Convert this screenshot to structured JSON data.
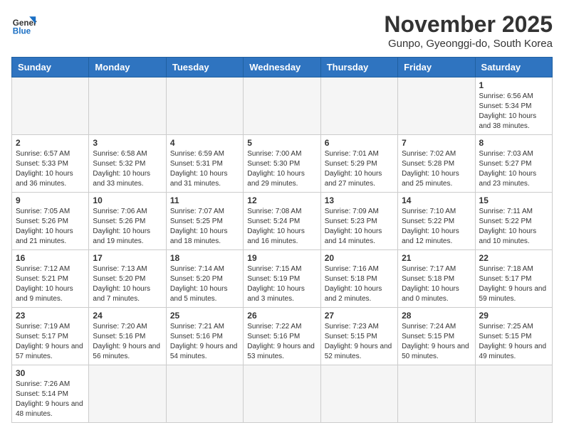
{
  "header": {
    "logo_general": "General",
    "logo_blue": "Blue",
    "title": "November 2025",
    "subtitle": "Gunpo, Gyeonggi-do, South Korea"
  },
  "weekdays": [
    "Sunday",
    "Monday",
    "Tuesday",
    "Wednesday",
    "Thursday",
    "Friday",
    "Saturday"
  ],
  "weeks": [
    [
      {
        "day": "",
        "info": ""
      },
      {
        "day": "",
        "info": ""
      },
      {
        "day": "",
        "info": ""
      },
      {
        "day": "",
        "info": ""
      },
      {
        "day": "",
        "info": ""
      },
      {
        "day": "",
        "info": ""
      },
      {
        "day": "1",
        "info": "Sunrise: 6:56 AM\nSunset: 5:34 PM\nDaylight: 10 hours and 38 minutes."
      }
    ],
    [
      {
        "day": "2",
        "info": "Sunrise: 6:57 AM\nSunset: 5:33 PM\nDaylight: 10 hours and 36 minutes."
      },
      {
        "day": "3",
        "info": "Sunrise: 6:58 AM\nSunset: 5:32 PM\nDaylight: 10 hours and 33 minutes."
      },
      {
        "day": "4",
        "info": "Sunrise: 6:59 AM\nSunset: 5:31 PM\nDaylight: 10 hours and 31 minutes."
      },
      {
        "day": "5",
        "info": "Sunrise: 7:00 AM\nSunset: 5:30 PM\nDaylight: 10 hours and 29 minutes."
      },
      {
        "day": "6",
        "info": "Sunrise: 7:01 AM\nSunset: 5:29 PM\nDaylight: 10 hours and 27 minutes."
      },
      {
        "day": "7",
        "info": "Sunrise: 7:02 AM\nSunset: 5:28 PM\nDaylight: 10 hours and 25 minutes."
      },
      {
        "day": "8",
        "info": "Sunrise: 7:03 AM\nSunset: 5:27 PM\nDaylight: 10 hours and 23 minutes."
      }
    ],
    [
      {
        "day": "9",
        "info": "Sunrise: 7:05 AM\nSunset: 5:26 PM\nDaylight: 10 hours and 21 minutes."
      },
      {
        "day": "10",
        "info": "Sunrise: 7:06 AM\nSunset: 5:26 PM\nDaylight: 10 hours and 19 minutes."
      },
      {
        "day": "11",
        "info": "Sunrise: 7:07 AM\nSunset: 5:25 PM\nDaylight: 10 hours and 18 minutes."
      },
      {
        "day": "12",
        "info": "Sunrise: 7:08 AM\nSunset: 5:24 PM\nDaylight: 10 hours and 16 minutes."
      },
      {
        "day": "13",
        "info": "Sunrise: 7:09 AM\nSunset: 5:23 PM\nDaylight: 10 hours and 14 minutes."
      },
      {
        "day": "14",
        "info": "Sunrise: 7:10 AM\nSunset: 5:22 PM\nDaylight: 10 hours and 12 minutes."
      },
      {
        "day": "15",
        "info": "Sunrise: 7:11 AM\nSunset: 5:22 PM\nDaylight: 10 hours and 10 minutes."
      }
    ],
    [
      {
        "day": "16",
        "info": "Sunrise: 7:12 AM\nSunset: 5:21 PM\nDaylight: 10 hours and 9 minutes."
      },
      {
        "day": "17",
        "info": "Sunrise: 7:13 AM\nSunset: 5:20 PM\nDaylight: 10 hours and 7 minutes."
      },
      {
        "day": "18",
        "info": "Sunrise: 7:14 AM\nSunset: 5:20 PM\nDaylight: 10 hours and 5 minutes."
      },
      {
        "day": "19",
        "info": "Sunrise: 7:15 AM\nSunset: 5:19 PM\nDaylight: 10 hours and 3 minutes."
      },
      {
        "day": "20",
        "info": "Sunrise: 7:16 AM\nSunset: 5:18 PM\nDaylight: 10 hours and 2 minutes."
      },
      {
        "day": "21",
        "info": "Sunrise: 7:17 AM\nSunset: 5:18 PM\nDaylight: 10 hours and 0 minutes."
      },
      {
        "day": "22",
        "info": "Sunrise: 7:18 AM\nSunset: 5:17 PM\nDaylight: 9 hours and 59 minutes."
      }
    ],
    [
      {
        "day": "23",
        "info": "Sunrise: 7:19 AM\nSunset: 5:17 PM\nDaylight: 9 hours and 57 minutes."
      },
      {
        "day": "24",
        "info": "Sunrise: 7:20 AM\nSunset: 5:16 PM\nDaylight: 9 hours and 56 minutes."
      },
      {
        "day": "25",
        "info": "Sunrise: 7:21 AM\nSunset: 5:16 PM\nDaylight: 9 hours and 54 minutes."
      },
      {
        "day": "26",
        "info": "Sunrise: 7:22 AM\nSunset: 5:16 PM\nDaylight: 9 hours and 53 minutes."
      },
      {
        "day": "27",
        "info": "Sunrise: 7:23 AM\nSunset: 5:15 PM\nDaylight: 9 hours and 52 minutes."
      },
      {
        "day": "28",
        "info": "Sunrise: 7:24 AM\nSunset: 5:15 PM\nDaylight: 9 hours and 50 minutes."
      },
      {
        "day": "29",
        "info": "Sunrise: 7:25 AM\nSunset: 5:15 PM\nDaylight: 9 hours and 49 minutes."
      }
    ],
    [
      {
        "day": "30",
        "info": "Sunrise: 7:26 AM\nSunset: 5:14 PM\nDaylight: 9 hours and 48 minutes."
      },
      {
        "day": "",
        "info": ""
      },
      {
        "day": "",
        "info": ""
      },
      {
        "day": "",
        "info": ""
      },
      {
        "day": "",
        "info": ""
      },
      {
        "day": "",
        "info": ""
      },
      {
        "day": "",
        "info": ""
      }
    ]
  ]
}
